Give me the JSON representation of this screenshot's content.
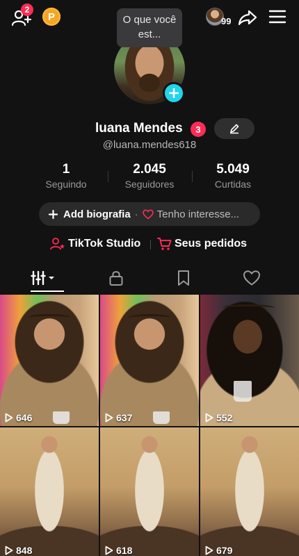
{
  "header": {
    "notification_count": "2",
    "coin_label": "P",
    "search_tooltip": "O que você est...",
    "friends_count": "99"
  },
  "profile": {
    "display_name": "luana Mendes",
    "name_badge": "3",
    "handle": "@luana.mendes618",
    "stats": [
      {
        "value": "1",
        "label": "Seguindo"
      },
      {
        "value": "2.045",
        "label": "Seguidores"
      },
      {
        "value": "5.049",
        "label": "Curtidas"
      }
    ],
    "bio_add": "Add biografia",
    "bio_separator": "·",
    "interest": "Tenho interesse..."
  },
  "links": {
    "studio": "TikTok Studio",
    "orders": "Seus pedidos"
  },
  "videos": [
    {
      "views": "646"
    },
    {
      "views": "637"
    },
    {
      "views": "552"
    },
    {
      "views": "848"
    },
    {
      "views": "618"
    },
    {
      "views": "679"
    }
  ],
  "colors": {
    "background": "#121212",
    "accent_red": "#fe2c55",
    "accent_cyan": "#20d5ec",
    "coin": "#f5a623"
  }
}
